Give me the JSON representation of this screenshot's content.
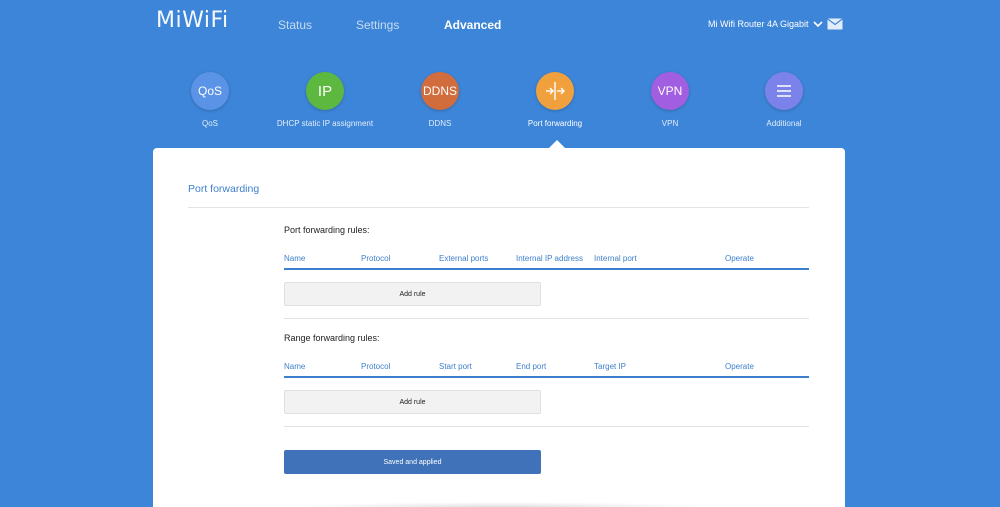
{
  "app": {
    "logo": "MiWiFi"
  },
  "nav": {
    "items": [
      {
        "label": "Status"
      },
      {
        "label": "Settings"
      },
      {
        "label": "Advanced"
      }
    ],
    "active": "Advanced"
  },
  "router": {
    "name": "Mi Wifi Router 4A Gigabit"
  },
  "features": [
    {
      "icon_text": "QoS",
      "label": "QoS",
      "color": "#5b93e6"
    },
    {
      "icon_text": "IP",
      "label": "DHCP static IP assignment",
      "color": "#5cb83f"
    },
    {
      "icon_text": "DDNS",
      "label": "DDNS",
      "color": "#d16c3d"
    },
    {
      "icon_text": "",
      "icon": "port-forwarding-icon",
      "label": "Port forwarding",
      "color": "#f0a03c"
    },
    {
      "icon_text": "VPN",
      "label": "VPN",
      "color": "#a25ee0"
    },
    {
      "icon_text": "",
      "icon": "menu-icon",
      "label": "Additional",
      "color": "#7b83ea"
    }
  ],
  "panel": {
    "title": "Port forwarding",
    "port_rules": {
      "title": "Port forwarding rules:",
      "headers": [
        "Name",
        "Protocol",
        "External ports",
        "Internal IP address",
        "Internal port",
        "Operate"
      ],
      "add_label": "Add rule"
    },
    "range_rules": {
      "title": "Range forwarding rules:",
      "headers": [
        "Name",
        "Protocol",
        "Start port",
        "End port",
        "Target IP",
        "Operate"
      ],
      "add_label": "Add rule"
    },
    "save_label": "Saved and applied"
  }
}
